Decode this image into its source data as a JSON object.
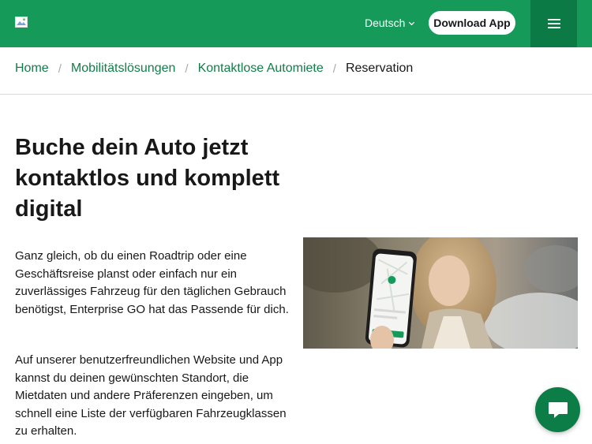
{
  "header": {
    "logo_alt": "Enterprise logo",
    "language": "Deutsch",
    "download_label": "Download App",
    "brand_color": "#169a5a",
    "menu_bg": "#0b7a45"
  },
  "breadcrumb": {
    "items": [
      "Home",
      "Mobilitätslösungen",
      "Kontaktlose Automiete"
    ],
    "current": "Reservation"
  },
  "main": {
    "title": "Buche dein Auto jetzt kontaktlos und komplett digital",
    "paragraph1": "Ganz gleich, ob du einen Roadtrip oder eine Geschäftsreise planst oder einfach nur ein zuverlässiges Fahrzeug für den täglichen Gebrauch benötigst, Enterprise GO hat das Passende für dich.",
    "paragraph2": "Auf unserer benutzerfreundlichen Website und App kannst du deinen gewünschten Standort, die Mietdaten und andere Präferenzen eingeben, um schnell eine Liste der verfügbaren Fahrzeugklassen zu erhalten.",
    "hero_alt": "Frau hält Smartphone mit Enterprise GO App"
  },
  "icons": {
    "chevron": "chevron-down-icon",
    "menu": "hamburger-menu-icon",
    "chat": "chat-bubble-icon"
  }
}
